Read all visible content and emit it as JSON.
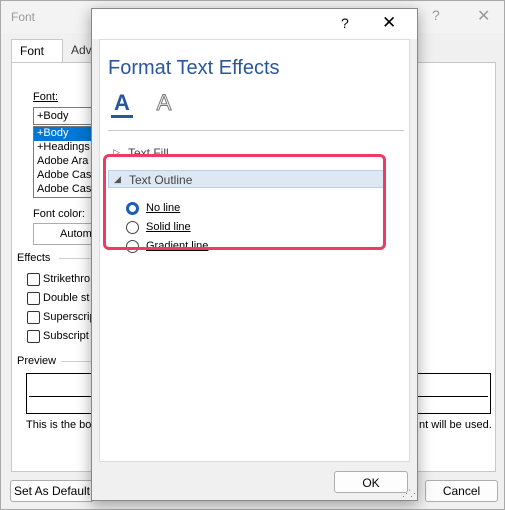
{
  "font_dialog": {
    "title": "Font",
    "help": "?",
    "close": "✕",
    "tabs": [
      "Font",
      "Adva"
    ],
    "font_label": "Font:",
    "font_value": "+Body",
    "font_list": [
      "+Body",
      "+Headings",
      "Adobe Ara",
      "Adobe Cas",
      "Adobe Cas"
    ],
    "font_color_label": "Font color:",
    "font_color_value": "Autom",
    "effects_label": "Effects",
    "effects": [
      "Strikethro",
      "Double st",
      "Superscrip",
      "Subscript"
    ],
    "preview_label": "Preview",
    "preview_text_left": "This is the bo",
    "preview_text_right": "nt will be used.",
    "set_default_label": "Set As Default",
    "cancel_label": "Cancel"
  },
  "format_text_effects": {
    "help": "?",
    "close": "✕",
    "title": "Format Text Effects",
    "icon_fill_text": "A",
    "icon_effects_text": "A",
    "sections": {
      "text_fill": "Text Fill",
      "text_outline": "Text Outline"
    },
    "outline_options": [
      {
        "label": "No line",
        "selected": true
      },
      {
        "label": "Solid line",
        "selected": false
      },
      {
        "label": "Gradient line",
        "selected": false
      }
    ],
    "ok_label": "OK"
  },
  "colors": {
    "accent": "#2b579a",
    "highlight": "#ee3b62",
    "radio_selected": "#1a5fb4"
  }
}
